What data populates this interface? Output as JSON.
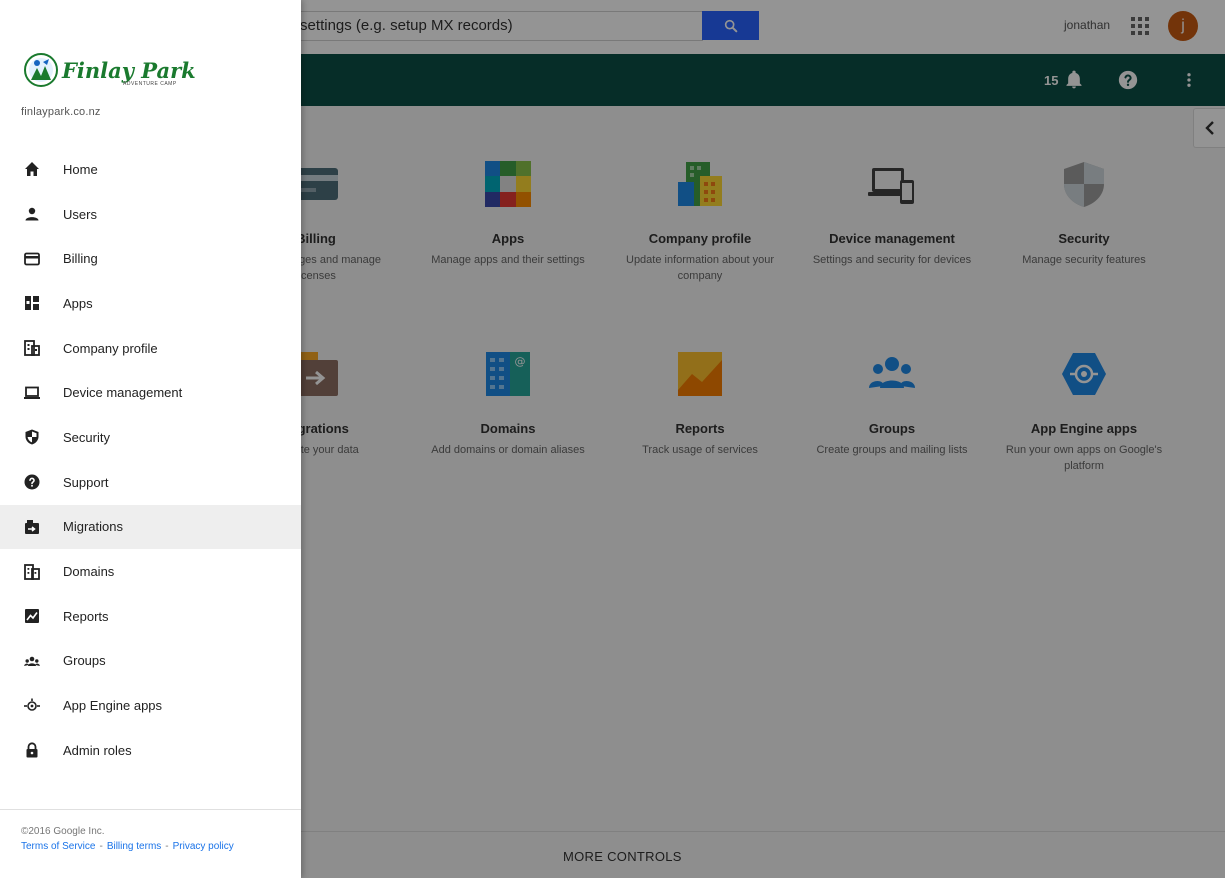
{
  "search": {
    "value": "apps, and settings (e.g. setup MX records)"
  },
  "header": {
    "user_name": "jonathan",
    "avatar_initial": "j",
    "notification_count": "15"
  },
  "tiles": [
    {
      "title": "Billing",
      "desc": "View charges and manage licenses",
      "icon": "billing-icon"
    },
    {
      "title": "Apps",
      "desc": "Manage apps and their settings",
      "icon": "apps-icon"
    },
    {
      "title": "Company profile",
      "desc": "Update information about your company",
      "icon": "company-profile-icon"
    },
    {
      "title": "Device management",
      "desc": "Settings and security for devices",
      "icon": "device-management-icon"
    },
    {
      "title": "Security",
      "desc": "Manage security features",
      "icon": "security-icon"
    },
    {
      "title": "Migrations",
      "desc": "Migrate your data",
      "icon": "migrations-icon"
    },
    {
      "title": "Domains",
      "desc": "Add domains or domain aliases",
      "icon": "domains-icon"
    },
    {
      "title": "Reports",
      "desc": "Track usage of services",
      "icon": "reports-icon"
    },
    {
      "title": "Groups",
      "desc": "Create groups and mailing lists",
      "icon": "groups-icon"
    },
    {
      "title": "App Engine apps",
      "desc": "Run your own apps on Google's platform",
      "icon": "app-engine-icon"
    }
  ],
  "footer": {
    "more_controls": "MORE CONTROLS"
  },
  "drawer": {
    "logo_text": "Finlay Park",
    "logo_subtext": "ADVENTURE CAMP",
    "domain": "finlaypark.co.nz",
    "items": [
      {
        "label": "Home",
        "icon": "home-icon"
      },
      {
        "label": "Users",
        "icon": "person-icon"
      },
      {
        "label": "Billing",
        "icon": "credit-card-icon"
      },
      {
        "label": "Apps",
        "icon": "apps-icon"
      },
      {
        "label": "Company profile",
        "icon": "building-icon"
      },
      {
        "label": "Device management",
        "icon": "laptop-icon"
      },
      {
        "label": "Security",
        "icon": "shield-icon"
      },
      {
        "label": "Support",
        "icon": "help-icon"
      },
      {
        "label": "Migrations",
        "icon": "migrations-icon",
        "active": true
      },
      {
        "label": "Domains",
        "icon": "domains-icon"
      },
      {
        "label": "Reports",
        "icon": "chart-icon"
      },
      {
        "label": "Groups",
        "icon": "group-icon"
      },
      {
        "label": "App Engine apps",
        "icon": "app-engine-icon"
      },
      {
        "label": "Admin roles",
        "icon": "lock-icon"
      }
    ],
    "copyright": "©2016 Google Inc.",
    "links": [
      "Terms of Service",
      "Billing terms",
      "Privacy policy"
    ],
    "link_separator": "-"
  },
  "colors": {
    "appbar": "#0b4f46",
    "search_button": "#2962ff",
    "avatar": "#c75b12",
    "link": "#1a73e8"
  }
}
